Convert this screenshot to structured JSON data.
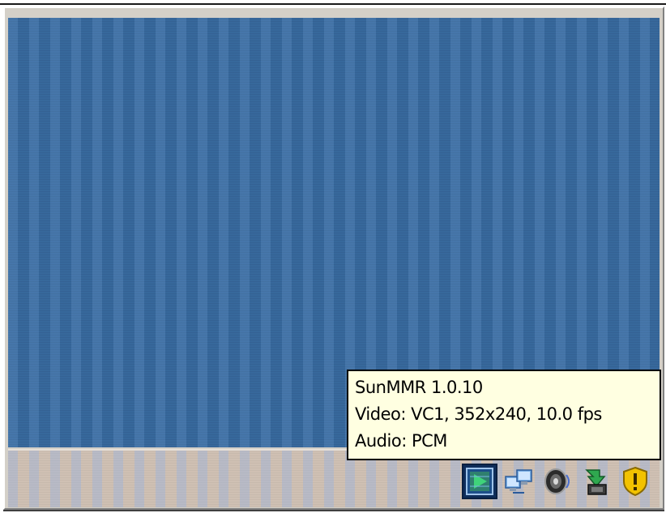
{
  "tooltip": {
    "line1": "SunMMR 1.0.10",
    "line2": "Video: VC1, 352x240, 10.0 fps",
    "line3": "Audio: PCM"
  },
  "tray": {
    "icons": [
      {
        "name": "media-player-icon",
        "active": true
      },
      {
        "name": "network-computers-icon",
        "active": false
      },
      {
        "name": "speaker-icon",
        "active": false
      },
      {
        "name": "safely-remove-hardware-icon",
        "active": false
      },
      {
        "name": "security-shield-icon",
        "active": false
      }
    ]
  },
  "colors": {
    "desktop": "#3a6ea5",
    "tooltip_bg": "#ffffe1",
    "shield": "#f2c200"
  }
}
